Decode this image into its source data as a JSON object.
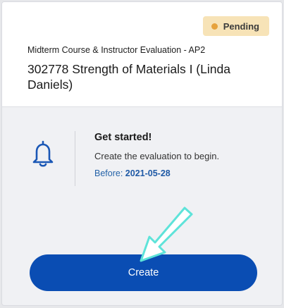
{
  "status": {
    "label": "Pending",
    "dot_color": "#e6a23c",
    "badge_color": "#f7e3b7"
  },
  "evaluation": {
    "subtitle": "Midterm Course & Instructor Evaluation - AP2",
    "title": "302778 Strength of Materials I (Linda Daniels)"
  },
  "notice": {
    "icon": "bell-icon",
    "heading": "Get started!",
    "description": "Create the evaluation to begin.",
    "before_label": "Before:",
    "before_date": "2021-05-28"
  },
  "actions": {
    "create_label": "Create",
    "create_color": "#0a4db3"
  },
  "annotation": {
    "icon": "pointer-arrow-icon",
    "color": "#5ee3d9"
  }
}
